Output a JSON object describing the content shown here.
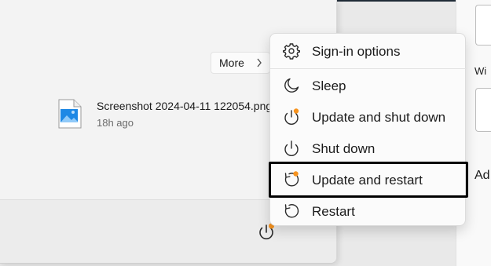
{
  "start_menu": {
    "more_label": "More",
    "recent": {
      "file_name": "Screenshot 2024-04-11 122054.png",
      "time": "18h ago"
    }
  },
  "power_menu": {
    "items": [
      {
        "label": "Sign-in options",
        "icon": "gear-icon"
      },
      {
        "label": "Sleep",
        "icon": "moon-icon"
      },
      {
        "label": "Update and shut down",
        "icon": "power-update-icon"
      },
      {
        "label": "Shut down",
        "icon": "power-icon"
      },
      {
        "label": "Update and restart",
        "icon": "restart-update-icon"
      },
      {
        "label": "Restart",
        "icon": "restart-icon"
      }
    ]
  },
  "settings": {
    "label_1": "Wi",
    "label_2": "Ad"
  },
  "colors": {
    "update_badge": "#f7931e",
    "highlight_border": "#000000"
  }
}
